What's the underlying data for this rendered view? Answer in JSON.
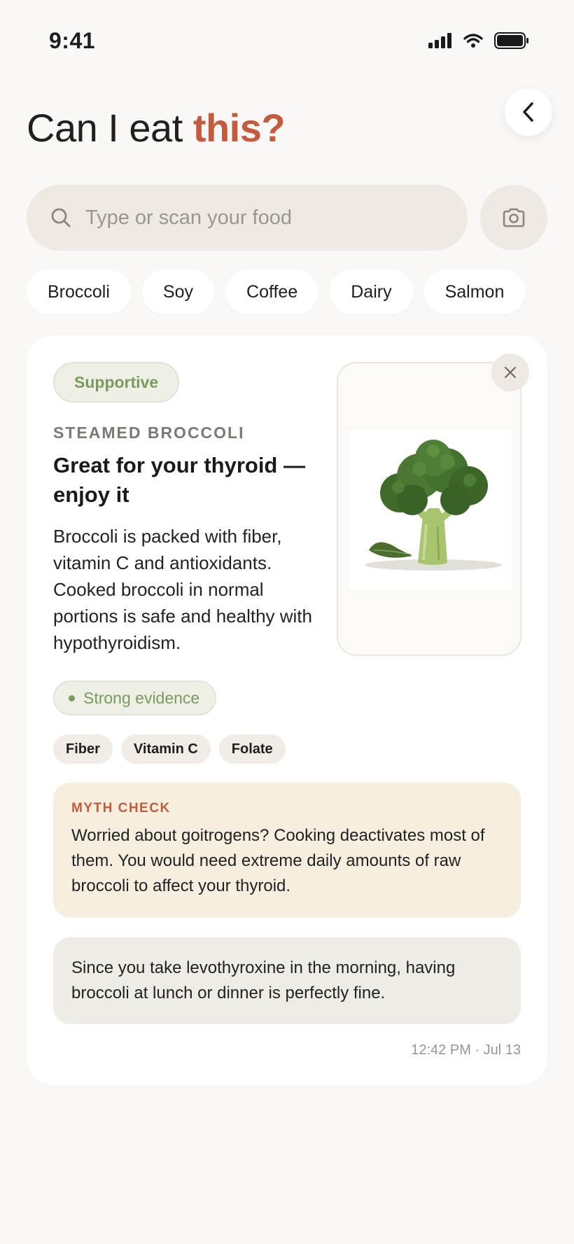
{
  "status_bar": {
    "time": "9:41"
  },
  "header": {
    "title_prefix": "Can I eat",
    "title_accent": "this?"
  },
  "search": {
    "placeholder": "Type or scan your food",
    "value": ""
  },
  "quick_picks": [
    "Broccoli",
    "Soy",
    "Coffee",
    "Dairy",
    "Salmon"
  ],
  "result": {
    "verdict_badge": "Supportive",
    "food_name": "STEAMED BROCCOLI",
    "headline": "Great for your thyroid — enjoy it",
    "description": "Broccoli is packed with fiber, vitamin C and antioxidants. Cooked broccoli in normal portions is safe and healthy with hypothyroidism.",
    "evidence": "Strong evidence",
    "nutrients": [
      "Fiber",
      "Vitamin C",
      "Folate"
    ],
    "myth_check": {
      "title": "MYTH CHECK",
      "text": "Worried about goitrogens? Cooking deactivates most of them. You would need extreme daily amounts of raw broccoli to affect your thyroid."
    },
    "personal_note": "Since you take levothyroxine in the morning, having broccoli at lunch or dinner is perfectly fine.",
    "timestamp": "12:42 PM · Jul 13"
  },
  "colors": {
    "accent": "#c45b3c",
    "supportive_green": "#7b9b5e",
    "background": "#f9f8f6",
    "myth_bg": "#f6efdf"
  },
  "icons": [
    "signal-icon",
    "wifi-icon",
    "battery-icon",
    "chevron-left-icon",
    "search-icon",
    "camera-icon",
    "close-icon",
    "broccoli-image"
  ]
}
